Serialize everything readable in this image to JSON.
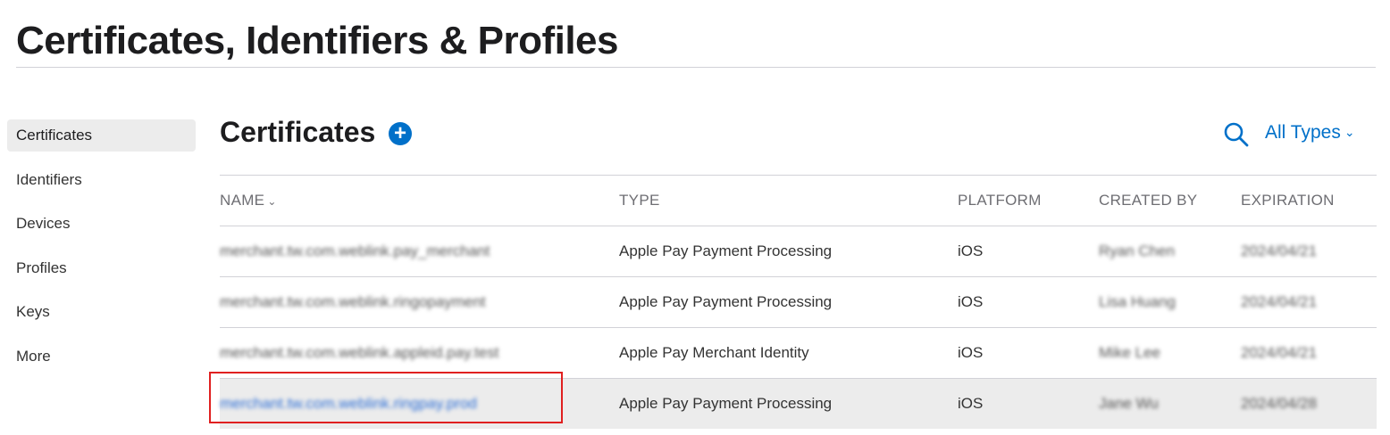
{
  "header": {
    "title": "Certificates, Identifiers & Profiles"
  },
  "sidebar": {
    "items": [
      {
        "label": "Certificates",
        "active": true
      },
      {
        "label": "Identifiers"
      },
      {
        "label": "Devices"
      },
      {
        "label": "Profiles"
      },
      {
        "label": "Keys"
      },
      {
        "label": "More"
      }
    ]
  },
  "main": {
    "section_title": "Certificates",
    "add_icon": "plus-circle-icon",
    "search_icon": "search-icon",
    "filter_label": "All Types",
    "columns": {
      "name": "NAME",
      "type": "TYPE",
      "platform": "PLATFORM",
      "created_by": "CREATED BY",
      "expiration": "EXPIRATION"
    },
    "rows": [
      {
        "name": "merchant.tw.com.weblink.pay_merchant",
        "type": "Apple Pay Payment Processing",
        "platform": "iOS",
        "created_by": "Ryan Chen",
        "expiration": "2024/04/21"
      },
      {
        "name": "merchant.tw.com.weblink.ringopayment",
        "type": "Apple Pay Payment Processing",
        "platform": "iOS",
        "created_by": "Lisa Huang",
        "expiration": "2024/04/21"
      },
      {
        "name": "merchant.tw.com.weblink.appleid.pay.test",
        "type": "Apple Pay Merchant Identity",
        "platform": "iOS",
        "created_by": "Mike Lee",
        "expiration": "2024/04/21"
      },
      {
        "name": "merchant.tw.com.weblink.ringpay.prod",
        "type": "Apple Pay Payment Processing",
        "platform": "iOS",
        "created_by": "Jane Wu",
        "expiration": "2024/04/28",
        "selected": true
      }
    ]
  },
  "colors": {
    "accent": "#0070c9",
    "highlight": "#e02020",
    "selected_row": "#ececec"
  }
}
